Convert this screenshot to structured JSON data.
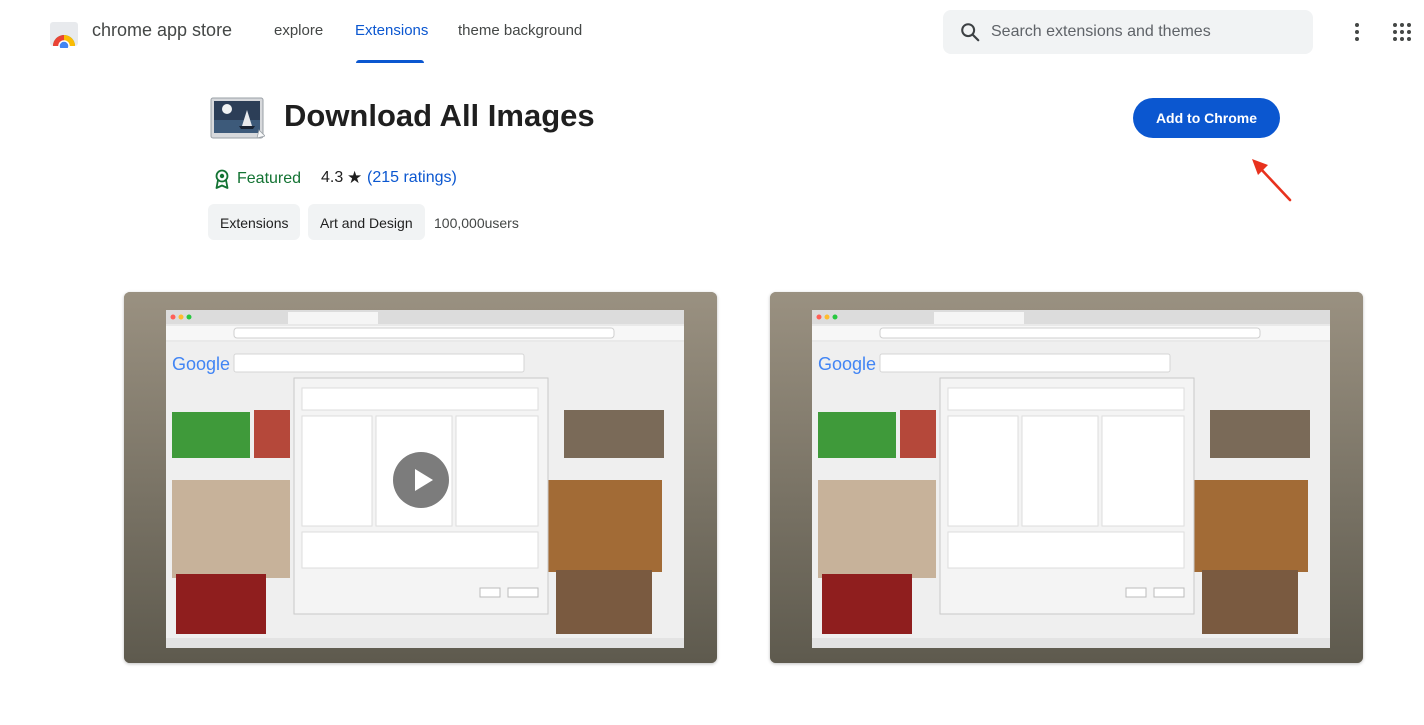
{
  "header": {
    "brand": "chrome app store",
    "tabs": [
      {
        "label": "explore",
        "active": false
      },
      {
        "label": "Extensions",
        "active": true
      },
      {
        "label": "theme background",
        "active": false
      }
    ],
    "search_placeholder": "Search extensions and themes"
  },
  "extension": {
    "title": "Download All Images",
    "add_label": "Add to Chrome",
    "featured_label": "Featured",
    "rating": "4.3",
    "star": "★",
    "ratings_count": "(215 ratings)",
    "chips": [
      "Extensions",
      "Art and Design"
    ],
    "users": "100,000users"
  },
  "colors": {
    "accent": "#0b57d0",
    "featured": "#137333",
    "arrow": "#e8321e"
  },
  "screenshots": [
    {
      "has_play": true
    },
    {
      "has_play": false
    }
  ]
}
